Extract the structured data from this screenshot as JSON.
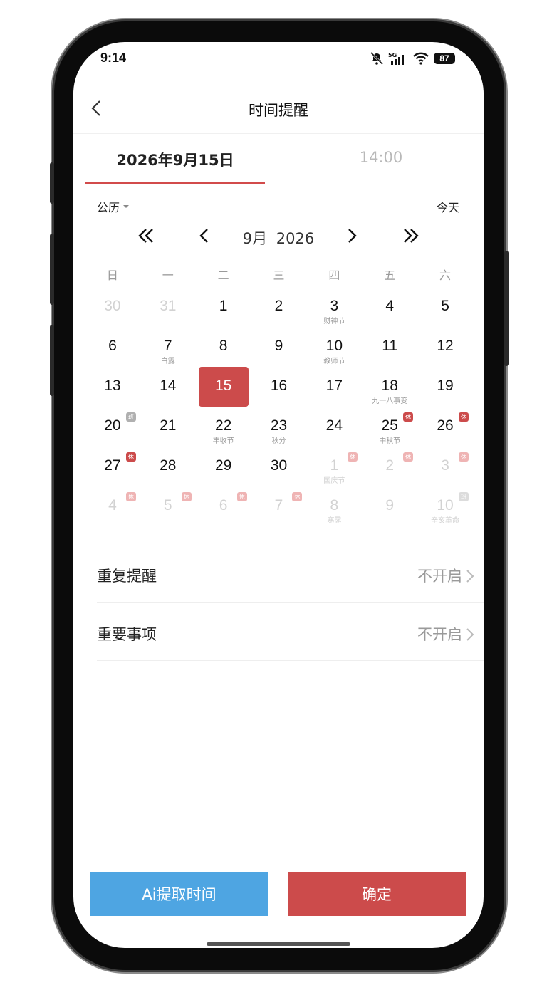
{
  "status_bar": {
    "time": "9:14",
    "battery": "87"
  },
  "header": {
    "title": "时间提醒"
  },
  "tabs": {
    "date": "2026年9月15日",
    "time": "14:00"
  },
  "calendar": {
    "type_label": "公历",
    "today_label": "今天",
    "month": "9月",
    "year": "2026",
    "weekdays": [
      "日",
      "一",
      "二",
      "三",
      "四",
      "五",
      "六"
    ],
    "days": [
      {
        "d": "30",
        "other": true
      },
      {
        "d": "31",
        "other": true
      },
      {
        "d": "1"
      },
      {
        "d": "2"
      },
      {
        "d": "3",
        "sub": "财神节"
      },
      {
        "d": "4"
      },
      {
        "d": "5"
      },
      {
        "d": "6"
      },
      {
        "d": "7",
        "sub": "白露"
      },
      {
        "d": "8"
      },
      {
        "d": "9"
      },
      {
        "d": "10",
        "sub": "教师节"
      },
      {
        "d": "11"
      },
      {
        "d": "12"
      },
      {
        "d": "13"
      },
      {
        "d": "14"
      },
      {
        "d": "15",
        "selected": true
      },
      {
        "d": "16"
      },
      {
        "d": "17"
      },
      {
        "d": "18",
        "sub": "九一八事变"
      },
      {
        "d": "19"
      },
      {
        "d": "20",
        "badge": "班",
        "badge_type": "work"
      },
      {
        "d": "21"
      },
      {
        "d": "22",
        "sub": "丰收节"
      },
      {
        "d": "23",
        "sub": "秋分"
      },
      {
        "d": "24"
      },
      {
        "d": "25",
        "sub": "中秋节",
        "badge": "休",
        "badge_type": "rest"
      },
      {
        "d": "26",
        "badge": "休",
        "badge_type": "rest"
      },
      {
        "d": "27",
        "badge": "休",
        "badge_type": "rest"
      },
      {
        "d": "28"
      },
      {
        "d": "29"
      },
      {
        "d": "30"
      },
      {
        "d": "1",
        "other": true,
        "sub": "国庆节",
        "badge": "休",
        "badge_type": "rest"
      },
      {
        "d": "2",
        "other": true,
        "badge": "休",
        "badge_type": "rest"
      },
      {
        "d": "3",
        "other": true,
        "badge": "休",
        "badge_type": "rest"
      },
      {
        "d": "4",
        "other": true,
        "badge": "休",
        "badge_type": "rest"
      },
      {
        "d": "5",
        "other": true,
        "badge": "休",
        "badge_type": "rest"
      },
      {
        "d": "6",
        "other": true,
        "badge": "休",
        "badge_type": "rest"
      },
      {
        "d": "7",
        "other": true,
        "badge": "休",
        "badge_type": "rest"
      },
      {
        "d": "8",
        "other": true,
        "sub": "寒露"
      },
      {
        "d": "9",
        "other": true
      },
      {
        "d": "10",
        "other": true,
        "sub": "辛亥革命",
        "badge": "班",
        "badge_type": "work"
      }
    ]
  },
  "settings": {
    "repeat": {
      "label": "重复提醒",
      "value": "不开启"
    },
    "important": {
      "label": "重要事项",
      "value": "不开启"
    }
  },
  "buttons": {
    "ai": "Ai提取时间",
    "confirm": "确定"
  },
  "colors": {
    "accent": "#cc4b4b",
    "ai_button": "#4ea5e2"
  }
}
